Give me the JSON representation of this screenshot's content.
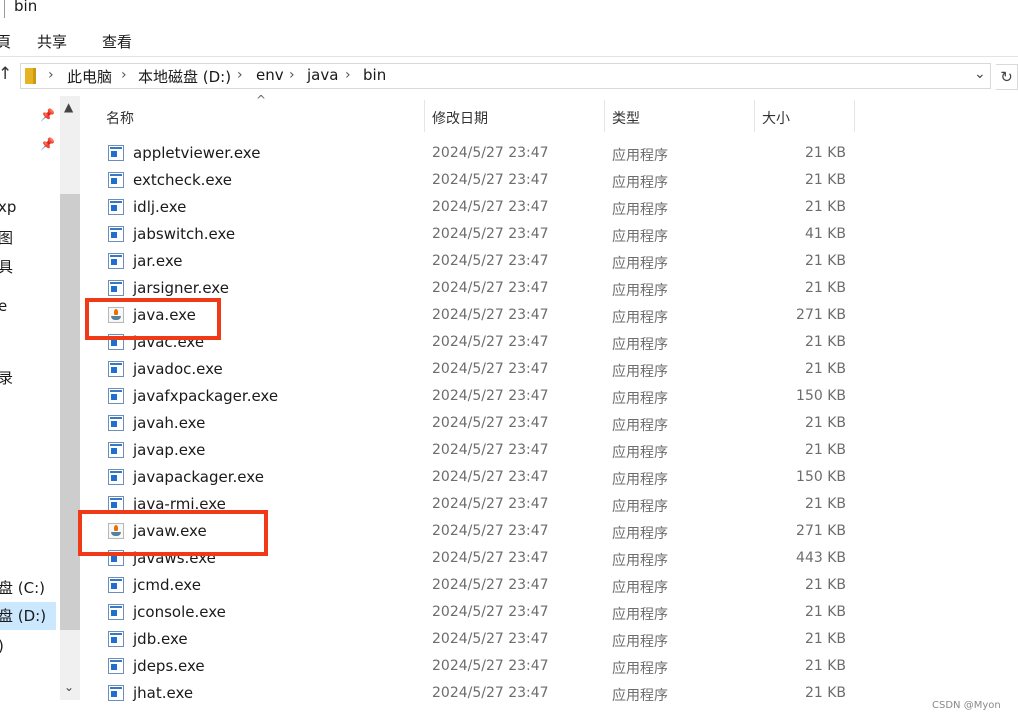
{
  "window": {
    "title": "bin"
  },
  "ribbon": {
    "cut_char": "頁",
    "tabs": [
      "共享",
      "查看"
    ]
  },
  "address": {
    "up_icon": "up-arrow-icon",
    "breadcrumb": [
      "此电脑",
      "本地磁盘 (D:)",
      "env",
      "java",
      "bin"
    ],
    "dropdown_icon": "chevron-down-icon",
    "refresh_icon": "refresh-icon"
  },
  "nav": {
    "items": [
      "xp",
      "图",
      "具",
      "e",
      "录",
      "盘 (C:)",
      "盘 (D:)",
      ")"
    ]
  },
  "columns": {
    "name": "名称",
    "date": "修改日期",
    "type": "类型",
    "size": "大小"
  },
  "files": [
    {
      "name": "appletviewer.exe",
      "date": "2024/5/27 23:47",
      "type": "应用程序",
      "size": "21 KB",
      "icon": "exe-icon"
    },
    {
      "name": "extcheck.exe",
      "date": "2024/5/27 23:47",
      "type": "应用程序",
      "size": "21 KB",
      "icon": "exe-icon"
    },
    {
      "name": "idlj.exe",
      "date": "2024/5/27 23:47",
      "type": "应用程序",
      "size": "21 KB",
      "icon": "exe-icon"
    },
    {
      "name": "jabswitch.exe",
      "date": "2024/5/27 23:47",
      "type": "应用程序",
      "size": "41 KB",
      "icon": "exe-icon"
    },
    {
      "name": "jar.exe",
      "date": "2024/5/27 23:47",
      "type": "应用程序",
      "size": "21 KB",
      "icon": "exe-icon"
    },
    {
      "name": "jarsigner.exe",
      "date": "2024/5/27 23:47",
      "type": "应用程序",
      "size": "21 KB",
      "icon": "exe-icon"
    },
    {
      "name": "java.exe",
      "date": "2024/5/27 23:47",
      "type": "应用程序",
      "size": "271 KB",
      "icon": "java-icon"
    },
    {
      "name": "javac.exe",
      "date": "2024/5/27 23:47",
      "type": "应用程序",
      "size": "21 KB",
      "icon": "exe-icon"
    },
    {
      "name": "javadoc.exe",
      "date": "2024/5/27 23:47",
      "type": "应用程序",
      "size": "21 KB",
      "icon": "exe-icon"
    },
    {
      "name": "javafxpackager.exe",
      "date": "2024/5/27 23:47",
      "type": "应用程序",
      "size": "150 KB",
      "icon": "exe-icon"
    },
    {
      "name": "javah.exe",
      "date": "2024/5/27 23:47",
      "type": "应用程序",
      "size": "21 KB",
      "icon": "exe-icon"
    },
    {
      "name": "javap.exe",
      "date": "2024/5/27 23:47",
      "type": "应用程序",
      "size": "21 KB",
      "icon": "exe-icon"
    },
    {
      "name": "javapackager.exe",
      "date": "2024/5/27 23:47",
      "type": "应用程序",
      "size": "150 KB",
      "icon": "exe-icon"
    },
    {
      "name": "java-rmi.exe",
      "date": "2024/5/27 23:47",
      "type": "应用程序",
      "size": "21 KB",
      "icon": "exe-icon"
    },
    {
      "name": "javaw.exe",
      "date": "2024/5/27 23:47",
      "type": "应用程序",
      "size": "271 KB",
      "icon": "java-icon"
    },
    {
      "name": "javaws.exe",
      "date": "2024/5/27 23:47",
      "type": "应用程序",
      "size": "443 KB",
      "icon": "exe-icon"
    },
    {
      "name": "jcmd.exe",
      "date": "2024/5/27 23:47",
      "type": "应用程序",
      "size": "21 KB",
      "icon": "exe-icon"
    },
    {
      "name": "jconsole.exe",
      "date": "2024/5/27 23:47",
      "type": "应用程序",
      "size": "21 KB",
      "icon": "exe-icon"
    },
    {
      "name": "jdb.exe",
      "date": "2024/5/27 23:47",
      "type": "应用程序",
      "size": "21 KB",
      "icon": "exe-icon"
    },
    {
      "name": "jdeps.exe",
      "date": "2024/5/27 23:47",
      "type": "应用程序",
      "size": "21 KB",
      "icon": "exe-icon"
    },
    {
      "name": "jhat.exe",
      "date": "2024/5/27 23:47",
      "type": "应用程序",
      "size": "21 KB",
      "icon": "exe-icon"
    }
  ],
  "highlight_color": "#f03a17",
  "selection_color": "#cce8ff",
  "watermark": "CSDN @Myon⁠"
}
